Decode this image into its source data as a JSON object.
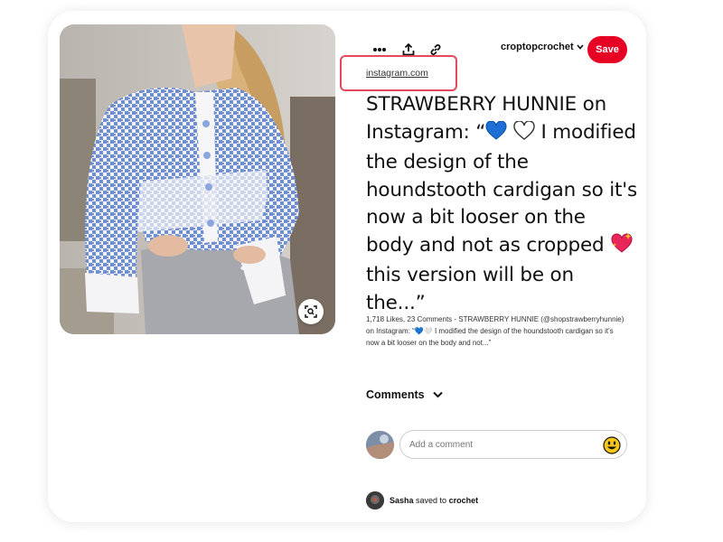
{
  "toolbar": {
    "more_icon": "more-horizontal-icon",
    "share_icon": "share-icon",
    "link_icon": "link-icon",
    "board_name": "croptopcrochet",
    "save_label": "Save"
  },
  "colors": {
    "save_button": "#e60023",
    "highlight_border": "#e3495a"
  },
  "source": {
    "domain": "instagram.com"
  },
  "pin": {
    "title_part1": "STRAWBERRY HUNNIE on Instagram: “",
    "title_part2": " I modified the design of the houndstooth cardigan so it's now a bit looser on the body and not as cropped ",
    "title_part3": " this version will be on the...”",
    "description": "1,718 Likes, 23 Comments - STRAWBERRY HUNNIE (@shopstrawberryhunnie) on Instagram: “💙🤍 I modified the design of the houndstooth cardigan so it's now a bit looser on the body and not...”"
  },
  "comments": {
    "header": "Comments",
    "placeholder": "Add a comment"
  },
  "saved_by": {
    "user": "Sasha",
    "action": " saved to ",
    "board": "crochet"
  }
}
